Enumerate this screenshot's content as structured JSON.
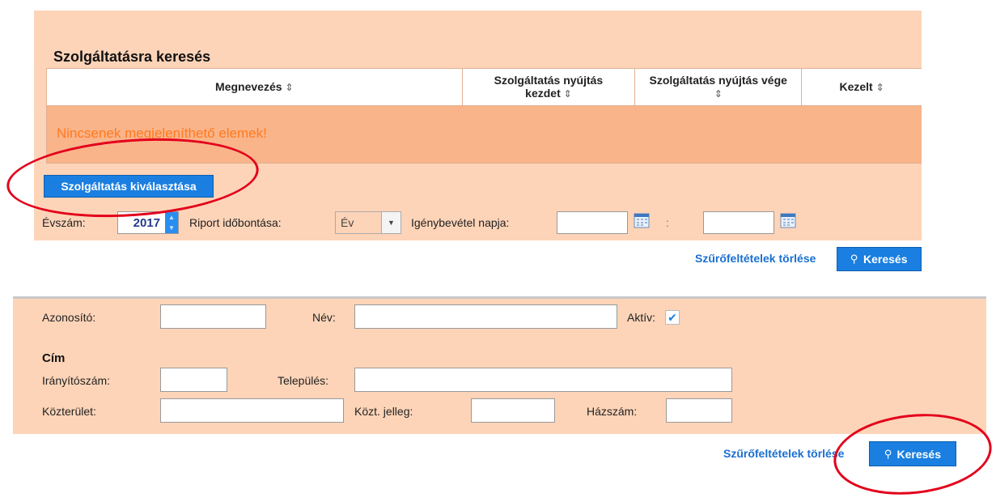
{
  "panel1": {
    "title": "Szolgáltatásra keresés",
    "table": {
      "columns": [
        {
          "line1": "Megnevezés",
          "line2": ""
        },
        {
          "line1": "Szolgáltatás nyújtás",
          "line2": "kezdet"
        },
        {
          "line1": "Szolgáltatás nyújtás vége",
          "line2": ""
        },
        {
          "line1": "Kezelt",
          "line2": ""
        }
      ],
      "sort_glyph": "⇕",
      "empty_message": "Nincsenek megjeleníthető elemek!"
    },
    "select_service_button": "Szolgáltatás kiválasztása",
    "filters": {
      "year_label": "Évszám:",
      "year_value": "2017",
      "period_label": "Riport időbontása:",
      "period_value": "Év",
      "date_label": "Igénybevétel napja:",
      "date_separator": ":"
    },
    "clear_filters_link": "Szűrőfeltételek törlése",
    "search_button": "Keresés"
  },
  "panel2": {
    "id_label": "Azonosító:",
    "name_label": "Név:",
    "active_label": "Aktív:",
    "active_checked": true,
    "address_heading": "Cím",
    "zip_label": "Irányítószám:",
    "city_label": "Település:",
    "street_label": "Közterület:",
    "street_type_label": "Közt. jelleg:",
    "house_no_label": "Házszám:",
    "clear_filters_link": "Szűrőfeltételek törlése",
    "search_button": "Keresés"
  },
  "colors": {
    "panel_bg": "#fdd4b8",
    "empty_row_bg": "#f9b48a",
    "accent_blue": "#1a7fe0",
    "warning_orange": "#ff7a1f",
    "annotation_red": "#e3001b"
  }
}
